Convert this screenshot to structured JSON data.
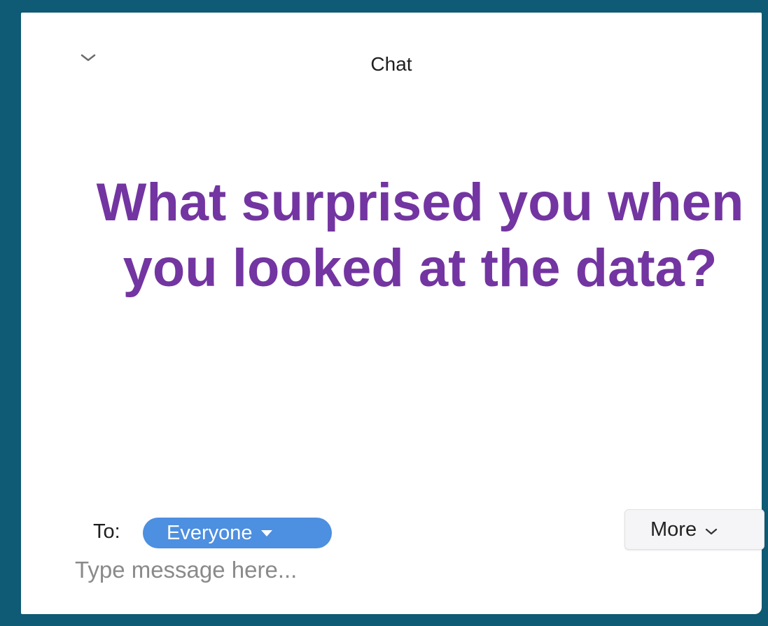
{
  "chat": {
    "title": "Chat",
    "question": "What surprised you when you looked at the data?",
    "to_label": "To:",
    "recipient": "Everyone",
    "more_label": "More",
    "input_placeholder": "Type message here..."
  },
  "colors": {
    "frame": "#0f5a74",
    "question_text": "#7335a1",
    "recipient_pill": "#4d8fe0"
  },
  "icons": {
    "collapse": "chevron-down-icon",
    "recipient_caret": "caret-down-icon",
    "more_chevron": "chevron-down-icon"
  }
}
